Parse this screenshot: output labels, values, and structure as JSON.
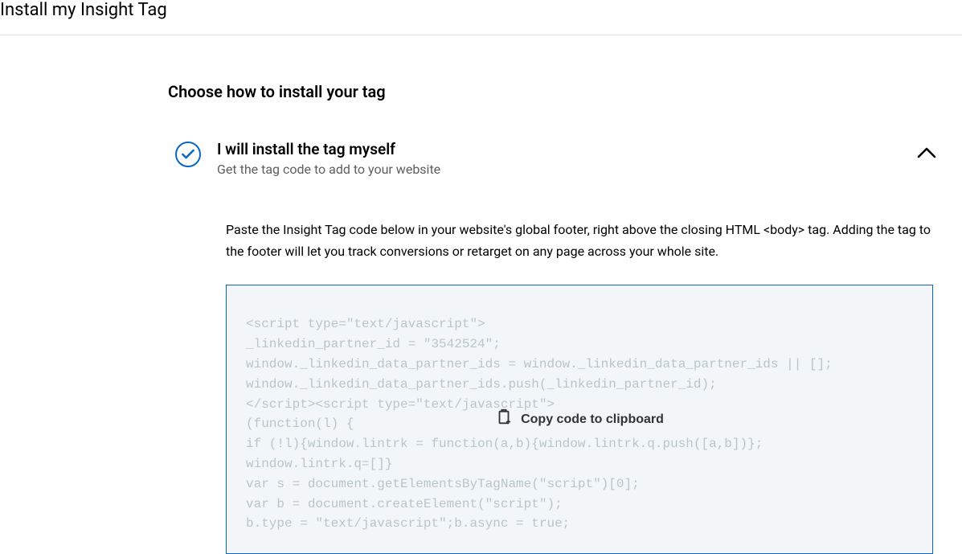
{
  "header": {
    "title": "Install my Insight Tag"
  },
  "main": {
    "section_title": "Choose how to install your tag",
    "accordion": {
      "title": "I will install the tag myself",
      "subtitle": "Get the tag code to add to your website",
      "instructions": "Paste the Insight Tag code below in your website's global footer, right above the closing HTML <body> tag. Adding the tag to the footer will let you track conversions or retarget on any page across your whole site.",
      "code": "<script type=\"text/javascript\">\n_linkedin_partner_id = \"3542524\";\nwindow._linkedin_data_partner_ids = window._linkedin_data_partner_ids || [];\nwindow._linkedin_data_partner_ids.push(_linkedin_partner_id);\n</script><script type=\"text/javascript\">\n(function(l) {\nif (!l){window.lintrk = function(a,b){window.lintrk.q.push([a,b])};\nwindow.lintrk.q=[]}\nvar s = document.getElementsByTagName(\"script\")[0];\nvar b = document.createElement(\"script\");\nb.type = \"text/javascript\";b.async = true;",
      "copy_label": "Copy code to clipboard"
    }
  }
}
